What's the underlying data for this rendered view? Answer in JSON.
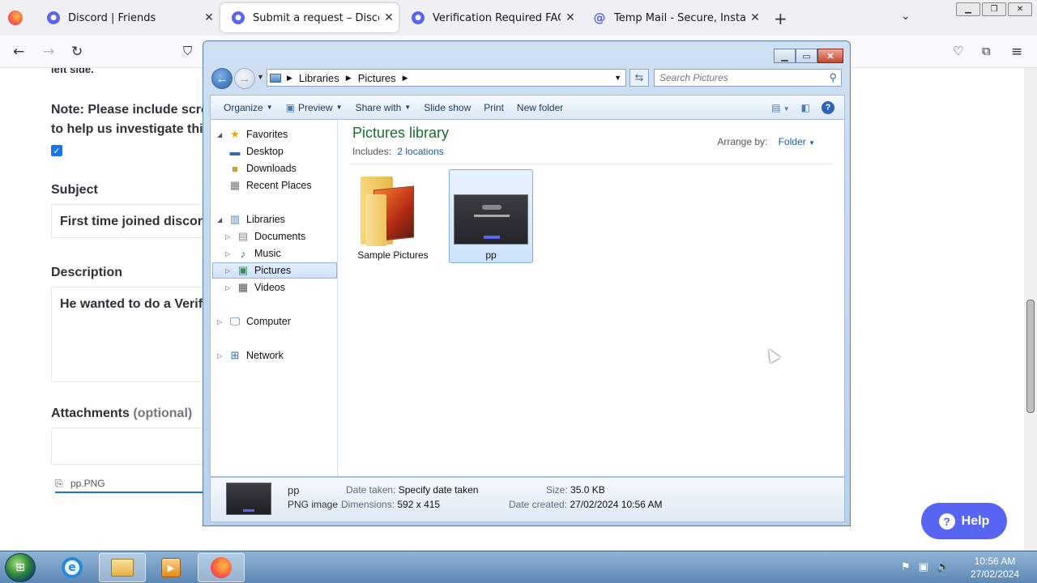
{
  "browser": {
    "tabs": [
      {
        "title": "Discord | Friends",
        "favicon": "discord-icon",
        "active": false
      },
      {
        "title": "Submit a request – Discord",
        "favicon": "discord-icon",
        "active": true
      },
      {
        "title": "Verification Required FAQ – Disc",
        "favicon": "discord-icon",
        "active": false
      },
      {
        "title": "Temp Mail - Secure, Instant, Fas",
        "favicon": "at-icon",
        "active": false
      }
    ],
    "newtab": "+",
    "close": "✕"
  },
  "page": {
    "partial_top": "left side.",
    "note_line1": "Note: Please include screen",
    "note_line2": "to help us investigate this f",
    "subject_label": "Subject",
    "subject_value": "First time joined discord",
    "description_label": "Description",
    "description_value": "He wanted to do a Verific",
    "attachments_label": "Attachments",
    "attachments_optional": "(optional)",
    "attachment_file": "pp.PNG",
    "help_button": "Help"
  },
  "explorer": {
    "breadcrumb": [
      "Libraries",
      "Pictures"
    ],
    "search_placeholder": "Search Pictures",
    "commands": [
      "Organize",
      "Preview",
      "Share with",
      "Slide show",
      "Print",
      "New folder"
    ],
    "nav": {
      "favorites": "Favorites",
      "fav_items": [
        "Desktop",
        "Downloads",
        "Recent Places"
      ],
      "libraries": "Libraries",
      "lib_items": [
        "Documents",
        "Music",
        "Pictures",
        "Videos"
      ],
      "computer": "Computer",
      "network": "Network"
    },
    "library_title": "Pictures library",
    "includes_label": "Includes:",
    "includes_link": "2 locations",
    "arrange_label": "Arrange by:",
    "arrange_value": "Folder",
    "files": [
      {
        "name": "Sample Pictures",
        "type": "folder"
      },
      {
        "name": "pp",
        "type": "image",
        "selected": true
      }
    ],
    "details": {
      "name": "pp",
      "type": "PNG image",
      "date_taken_label": "Date taken:",
      "date_taken_value": "Specify date taken",
      "dimensions_label": "Dimensions:",
      "dimensions_value": "592 x 415",
      "size_label": "Size:",
      "size_value": "35.0 KB",
      "date_created_label": "Date created:",
      "date_created_value": "27/02/2024 10:56 AM"
    }
  },
  "taskbar": {
    "time": "10:56 AM",
    "date": "27/02/2024"
  }
}
